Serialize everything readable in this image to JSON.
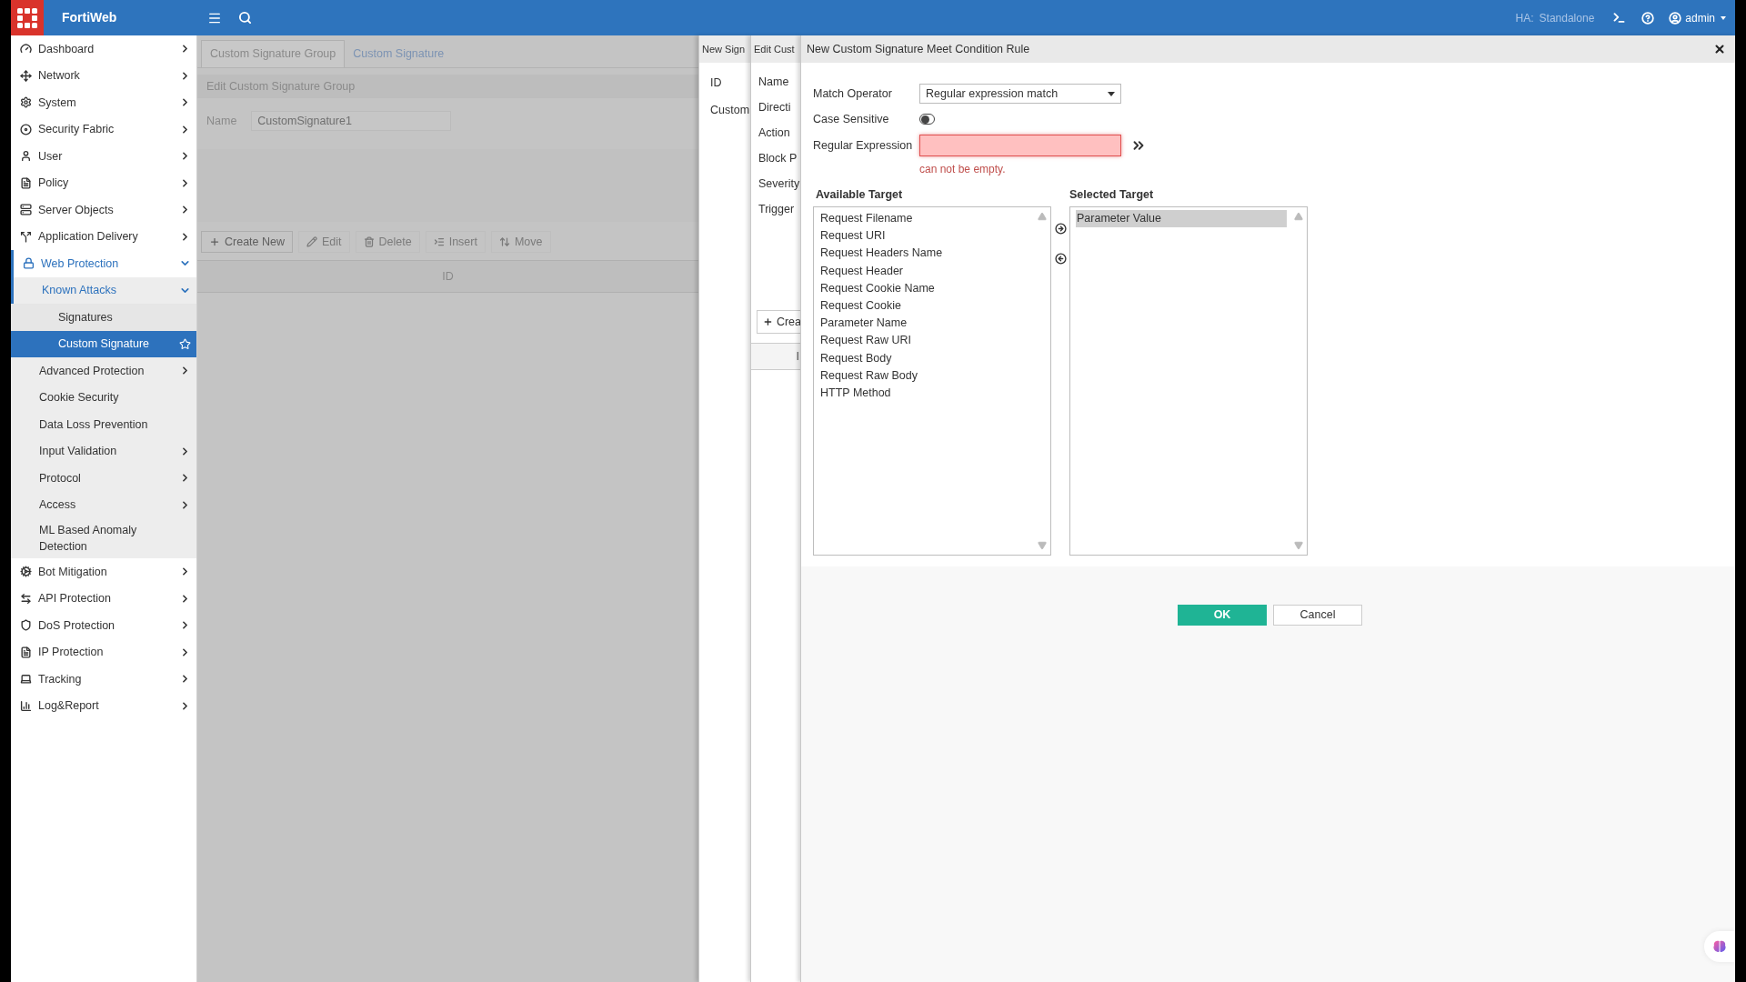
{
  "topbar": {
    "brand": "FortiWeb",
    "ha_label": "HA:",
    "ha_value": "Standalone",
    "user": "admin"
  },
  "sidebar": {
    "items": [
      {
        "label": "Dashboard",
        "expanded": false,
        "selected": false
      },
      {
        "label": "Network",
        "expanded": false,
        "selected": false
      },
      {
        "label": "System",
        "expanded": false,
        "selected": false
      },
      {
        "label": "Security Fabric",
        "expanded": false,
        "selected": false
      },
      {
        "label": "User",
        "expanded": false,
        "selected": false
      },
      {
        "label": "Policy",
        "expanded": false,
        "selected": false
      },
      {
        "label": "Server Objects",
        "expanded": false,
        "selected": false
      },
      {
        "label": "Application Delivery",
        "expanded": false,
        "selected": false
      },
      {
        "label": "Web Protection",
        "expanded": true,
        "selected": false,
        "children": [
          {
            "label": "Known Attacks",
            "expanded": true,
            "selected": false,
            "children": [
              {
                "label": "Signatures",
                "selected": false
              },
              {
                "label": "Custom Signature",
                "selected": true
              }
            ]
          },
          {
            "label": "Advanced Protection",
            "expanded": false,
            "selected": false
          },
          {
            "label": "Cookie Security",
            "selected": false
          },
          {
            "label": "Data Loss Prevention",
            "selected": false
          },
          {
            "label": "Input Validation",
            "expanded": false,
            "selected": false
          },
          {
            "label": "Protocol",
            "expanded": false,
            "selected": false
          },
          {
            "label": "Access",
            "expanded": false,
            "selected": false
          },
          {
            "label": "ML Based Anomaly Detection",
            "selected": false
          }
        ]
      },
      {
        "label": "Bot Mitigation",
        "expanded": false,
        "selected": false
      },
      {
        "label": "API Protection",
        "expanded": false,
        "selected": false
      },
      {
        "label": "DoS Protection",
        "expanded": false,
        "selected": false
      },
      {
        "label": "IP Protection",
        "expanded": false,
        "selected": false
      },
      {
        "label": "Tracking",
        "expanded": false,
        "selected": false
      },
      {
        "label": "Log&Report",
        "expanded": false,
        "selected": false
      }
    ]
  },
  "group_page": {
    "tabs": [
      {
        "label": "Custom Signature Group",
        "selected": true
      },
      {
        "label": "Custom Signature",
        "selected": false
      }
    ],
    "section_title": "Edit Custom Signature Group",
    "name_label": "Name",
    "name_value": "CustomSignature1",
    "toolbar": [
      {
        "label": "Create New",
        "disabled": false
      },
      {
        "label": "Edit",
        "disabled": true
      },
      {
        "label": "Delete",
        "disabled": true
      },
      {
        "label": "Insert",
        "disabled": true
      },
      {
        "label": "Move",
        "disabled": true
      }
    ],
    "table": {
      "columns": [
        "ID"
      ]
    }
  },
  "signature_panel": {
    "title": "New Sign",
    "labels": [
      "ID",
      "Custom"
    ]
  },
  "edit_panel": {
    "title": "Edit Cust",
    "labels": [
      "Name",
      "Directi",
      "Action",
      "Block P",
      "Severity",
      "Trigger"
    ],
    "create_button": "Crea",
    "table": {
      "columns": [
        "I"
      ]
    }
  },
  "dialog": {
    "title": "New Custom Signature Meet Condition Rule",
    "match_operator": {
      "label": "Match Operator",
      "value": "Regular expression match"
    },
    "case_sensitive": {
      "label": "Case Sensitive",
      "on": false
    },
    "regular_expression": {
      "label": "Regular Expression",
      "error": true,
      "error_text": "can not be empty."
    },
    "available_target": {
      "title": "Available Target",
      "items": [
        {
          "label": "Request Filename",
          "selected": false
        },
        {
          "label": "Request URI",
          "selected": false
        },
        {
          "label": "Request Headers Name",
          "selected": false
        },
        {
          "label": "Request Header",
          "selected": false
        },
        {
          "label": "Request Cookie Name",
          "selected": false
        },
        {
          "label": "Request Cookie",
          "selected": false
        },
        {
          "label": "Parameter Name",
          "selected": false
        },
        {
          "label": "Request Raw URI",
          "selected": false
        },
        {
          "label": "Request Body",
          "selected": false
        },
        {
          "label": "Request Raw Body",
          "selected": false
        },
        {
          "label": "HTTP Method",
          "selected": false
        }
      ]
    },
    "selected_target": {
      "title": "Selected Target",
      "items": [
        {
          "label": "Parameter Value",
          "selected": true
        }
      ]
    },
    "buttons": [
      {
        "label": "OK",
        "kind": "primary"
      },
      {
        "label": "Cancel",
        "kind": "secondary"
      }
    ]
  }
}
